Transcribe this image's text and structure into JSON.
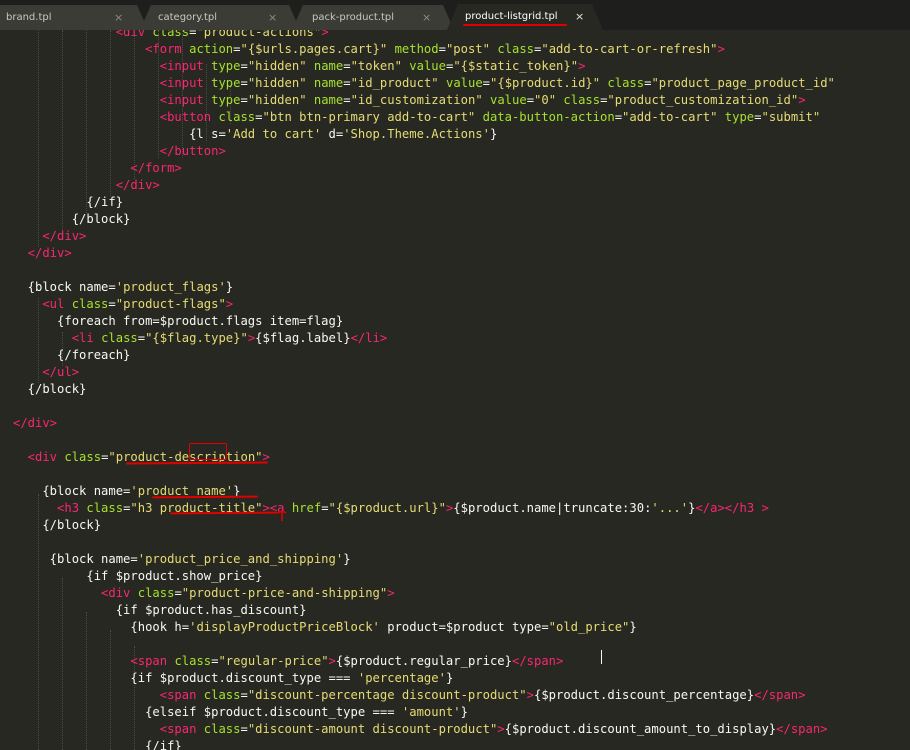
{
  "tabs": [
    {
      "label": "brand.tpl",
      "close": "×",
      "active": false
    },
    {
      "label": "category.tpl",
      "close": "×",
      "active": false
    },
    {
      "label": "pack-product.tpl",
      "close": "×",
      "active": false
    },
    {
      "label": "product-listgrid.tpl",
      "close": "×",
      "active": true
    }
  ],
  "colors": {
    "background": "#272822",
    "tag": "#f92672",
    "attribute": "#a6e22e",
    "string": "#e6db74",
    "text": "#f8f8f2",
    "annotation": "#e00000"
  },
  "code_lines": [
    [
      [
        "tag",
        "              <div "
      ],
      [
        "attr",
        "class"
      ],
      [
        "text",
        "="
      ],
      [
        "str",
        "\"product-actions\""
      ],
      [
        "tag",
        ">"
      ]
    ],
    [
      [
        "tag",
        "                  <form "
      ],
      [
        "attr",
        "action"
      ],
      [
        "text",
        "="
      ],
      [
        "str",
        "\"{$urls.pages.cart}\""
      ],
      [
        "text",
        " "
      ],
      [
        "attr",
        "method"
      ],
      [
        "text",
        "="
      ],
      [
        "str",
        "\"post\""
      ],
      [
        "text",
        " "
      ],
      [
        "attr",
        "class"
      ],
      [
        "text",
        "="
      ],
      [
        "str",
        "\"add-to-cart-or-refresh\""
      ],
      [
        "tag",
        ">"
      ]
    ],
    [
      [
        "tag",
        "                    <input "
      ],
      [
        "attr",
        "type"
      ],
      [
        "text",
        "="
      ],
      [
        "str",
        "\"hidden\""
      ],
      [
        "text",
        " "
      ],
      [
        "attr",
        "name"
      ],
      [
        "text",
        "="
      ],
      [
        "str",
        "\"token\""
      ],
      [
        "text",
        " "
      ],
      [
        "attr",
        "value"
      ],
      [
        "text",
        "="
      ],
      [
        "str",
        "\"{$static_token}\""
      ],
      [
        "tag",
        ">"
      ]
    ],
    [
      [
        "tag",
        "                    <input "
      ],
      [
        "attr",
        "type"
      ],
      [
        "text",
        "="
      ],
      [
        "str",
        "\"hidden\""
      ],
      [
        "text",
        " "
      ],
      [
        "attr",
        "name"
      ],
      [
        "text",
        "="
      ],
      [
        "str",
        "\"id_product\""
      ],
      [
        "text",
        " "
      ],
      [
        "attr",
        "value"
      ],
      [
        "text",
        "="
      ],
      [
        "str",
        "\"{$product.id}\""
      ],
      [
        "text",
        " "
      ],
      [
        "attr",
        "class"
      ],
      [
        "text",
        "="
      ],
      [
        "str",
        "\"product_page_product_id\""
      ]
    ],
    [
      [
        "tag",
        "                    <input "
      ],
      [
        "attr",
        "type"
      ],
      [
        "text",
        "="
      ],
      [
        "str",
        "\"hidden\""
      ],
      [
        "text",
        " "
      ],
      [
        "attr",
        "name"
      ],
      [
        "text",
        "="
      ],
      [
        "str",
        "\"id_customization\""
      ],
      [
        "text",
        " "
      ],
      [
        "attr",
        "value"
      ],
      [
        "text",
        "="
      ],
      [
        "str",
        "\"0\""
      ],
      [
        "text",
        " "
      ],
      [
        "attr",
        "class"
      ],
      [
        "text",
        "="
      ],
      [
        "str",
        "\"product_customization_id\""
      ],
      [
        "tag",
        ">"
      ]
    ],
    [
      [
        "tag",
        "                    <button "
      ],
      [
        "attr",
        "class"
      ],
      [
        "text",
        "="
      ],
      [
        "str",
        "\"btn btn-primary add-to-cart\""
      ],
      [
        "text",
        " "
      ],
      [
        "attr",
        "data-button-action"
      ],
      [
        "text",
        "="
      ],
      [
        "str",
        "\"add-to-cart\""
      ],
      [
        "text",
        " "
      ],
      [
        "attr",
        "type"
      ],
      [
        "text",
        "="
      ],
      [
        "str",
        "\"submit\""
      ]
    ],
    [
      [
        "text",
        "                        {l s="
      ],
      [
        "str",
        "'Add to cart'"
      ],
      [
        "text",
        " d="
      ],
      [
        "str",
        "'Shop.Theme.Actions'"
      ],
      [
        "text",
        "}"
      ]
    ],
    [
      [
        "tag",
        "                    </button>"
      ]
    ],
    [
      [
        "tag",
        "                </form>"
      ]
    ],
    [
      [
        "tag",
        "              </div>"
      ]
    ],
    [
      [
        "text",
        "          {/if}"
      ]
    ],
    [
      [
        "text",
        "        {/block}"
      ]
    ],
    [
      [
        "tag",
        "    </div>"
      ]
    ],
    [
      [
        "tag",
        "  </div>"
      ]
    ],
    [
      [
        "text",
        ""
      ]
    ],
    [
      [
        "text",
        "  {block name="
      ],
      [
        "str",
        "'product_flags'"
      ],
      [
        "text",
        "}"
      ]
    ],
    [
      [
        "tag",
        "    <ul "
      ],
      [
        "attr",
        "class"
      ],
      [
        "text",
        "="
      ],
      [
        "str",
        "\"product-flags\""
      ],
      [
        "tag",
        ">"
      ]
    ],
    [
      [
        "text",
        "      {foreach from=$product.flags item=flag}"
      ]
    ],
    [
      [
        "tag",
        "        <li "
      ],
      [
        "attr",
        "class"
      ],
      [
        "text",
        "="
      ],
      [
        "str",
        "\"{$flag.type}\""
      ],
      [
        "tag",
        ">"
      ],
      [
        "text",
        "{$flag.label}"
      ],
      [
        "tag",
        "</li>"
      ]
    ],
    [
      [
        "text",
        "      {/foreach}"
      ]
    ],
    [
      [
        "tag",
        "    </ul>"
      ]
    ],
    [
      [
        "text",
        "  {/block}"
      ]
    ],
    [
      [
        "text",
        ""
      ]
    ],
    [
      [
        "tag",
        "</div>"
      ]
    ],
    [
      [
        "text",
        ""
      ]
    ],
    [
      [
        "tag",
        "  <div "
      ],
      [
        "attr",
        "class"
      ],
      [
        "text",
        "="
      ],
      [
        "str",
        "\"product-description\""
      ],
      [
        "tag",
        ">"
      ]
    ],
    [
      [
        "text",
        ""
      ]
    ],
    [
      [
        "text",
        "    {block name="
      ],
      [
        "str",
        "'product_name'"
      ],
      [
        "text",
        "}"
      ]
    ],
    [
      [
        "tag",
        "      <h3 "
      ],
      [
        "attr",
        "class"
      ],
      [
        "text",
        "="
      ],
      [
        "str",
        "\"h3 product-title\""
      ],
      [
        "tag",
        "><a "
      ],
      [
        "attr",
        "href"
      ],
      [
        "text",
        "="
      ],
      [
        "str",
        "\"{$product.url}\""
      ],
      [
        "tag",
        ">"
      ],
      [
        "text",
        "{$product.name|truncate:30:"
      ],
      [
        "str",
        "'...'"
      ],
      [
        "text",
        "}"
      ],
      [
        "tag",
        "</a></h3 >"
      ]
    ],
    [
      [
        "text",
        "    {/block}"
      ]
    ],
    [
      [
        "text",
        ""
      ]
    ],
    [
      [
        "text",
        "     {block name="
      ],
      [
        "str",
        "'product_price_and_shipping'"
      ],
      [
        "text",
        "}"
      ]
    ],
    [
      [
        "text",
        "          {if $product.show_price}"
      ]
    ],
    [
      [
        "tag",
        "            <div "
      ],
      [
        "attr",
        "class"
      ],
      [
        "text",
        "="
      ],
      [
        "str",
        "\"product-price-and-shipping\""
      ],
      [
        "tag",
        ">"
      ]
    ],
    [
      [
        "text",
        "              {if $product.has_discount}"
      ]
    ],
    [
      [
        "text",
        "                {hook h="
      ],
      [
        "str",
        "'displayProductPriceBlock'"
      ],
      [
        "text",
        " product=$product type="
      ],
      [
        "str",
        "\"old_price\""
      ],
      [
        "text",
        "}"
      ]
    ],
    [
      [
        "text",
        ""
      ]
    ],
    [
      [
        "tag",
        "                <span "
      ],
      [
        "attr",
        "class"
      ],
      [
        "text",
        "="
      ],
      [
        "str",
        "\"regular-price\""
      ],
      [
        "tag",
        ">"
      ],
      [
        "text",
        "{$product.regular_price}"
      ],
      [
        "tag",
        "</span>"
      ]
    ],
    [
      [
        "text",
        "                {if $product.discount_type === "
      ],
      [
        "str",
        "'percentage'"
      ],
      [
        "text",
        "}"
      ]
    ],
    [
      [
        "tag",
        "                    <span "
      ],
      [
        "attr",
        "class"
      ],
      [
        "text",
        "="
      ],
      [
        "str",
        "\"discount-percentage discount-product\""
      ],
      [
        "tag",
        ">"
      ],
      [
        "text",
        "{$product.discount_percentage}"
      ],
      [
        "tag",
        "</span>"
      ]
    ],
    [
      [
        "text",
        "                  {elseif $product.discount_type === "
      ],
      [
        "str",
        "'amount'"
      ],
      [
        "text",
        "}"
      ]
    ],
    [
      [
        "tag",
        "                    <span "
      ],
      [
        "attr",
        "class"
      ],
      [
        "text",
        "="
      ],
      [
        "str",
        "\"discount-amount discount-product\""
      ],
      [
        "tag",
        ">"
      ],
      [
        "text",
        "{$product.discount_amount_to_display}"
      ],
      [
        "tag",
        "</span>"
      ]
    ],
    [
      [
        "text",
        "                  {/if}"
      ]
    ]
  ]
}
